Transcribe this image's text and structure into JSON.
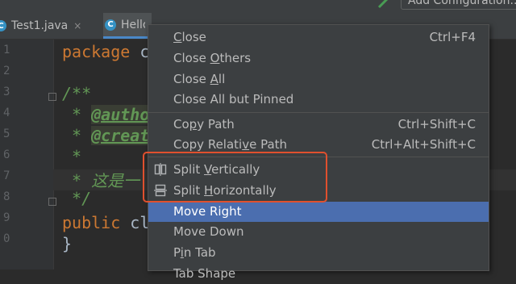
{
  "toolbar": {
    "config_label": "Add Configuration..."
  },
  "tabs": [
    {
      "label": "Test1.java",
      "icon": "C",
      "close": "×"
    },
    {
      "label": "Hello.java",
      "icon": "C"
    }
  ],
  "line_numbers": [
    "1",
    "2",
    "3",
    "4",
    "5",
    "6",
    "7",
    "8",
    "9",
    "0"
  ],
  "code": {
    "line1_kw": "package",
    "line1_rest": " c",
    "line3": "/**",
    "line4_star": " * ",
    "line4_tag": "@autho",
    "line5_star": " * ",
    "line5_tag": "@creat",
    "line6": " *",
    "line7": " * 这是一",
    "line8": " */",
    "line9_kw": "public",
    "line9_rest": " cl",
    "line10": "}"
  },
  "menu": {
    "close": {
      "label_u": "C",
      "label_rest": "lose",
      "shortcut": "Ctrl+F4"
    },
    "close_others": {
      "label_pre": "Close ",
      "label_u": "O",
      "label_rest": "thers"
    },
    "close_all": {
      "label_pre": "Close ",
      "label_u": "A",
      "label_rest": "ll"
    },
    "close_all_but_pinned": {
      "label": "Close All but Pinned"
    },
    "copy_path": {
      "label_pre": "Co",
      "label_u": "p",
      "label_rest": "y Path",
      "shortcut": "Ctrl+Shift+C"
    },
    "copy_relative_path": {
      "label_pre": "Copy Relati",
      "label_u": "v",
      "label_rest": "e Path",
      "shortcut": "Ctrl+Alt+Shift+C"
    },
    "split_vertically": {
      "label_pre": "Split ",
      "label_u": "V",
      "label_rest": "ertically",
      "icon": "split-vertical-icon"
    },
    "split_horizontally": {
      "label_pre": "Split ",
      "label_u": "H",
      "label_rest": "orizontally",
      "icon": "split-horizontal-icon"
    },
    "move_right": {
      "label": "Move Right"
    },
    "move_down": {
      "label": "Move Down"
    },
    "pin_tab": {
      "label_pre": "P",
      "label_u": "i",
      "label_rest": "n Tab"
    },
    "tab_shape": {
      "label": "Tab Shape"
    }
  },
  "colors": {
    "accent": "#4b6eaf",
    "highlight_box": "#e0502e",
    "menu_bg": "#3c3f41"
  }
}
